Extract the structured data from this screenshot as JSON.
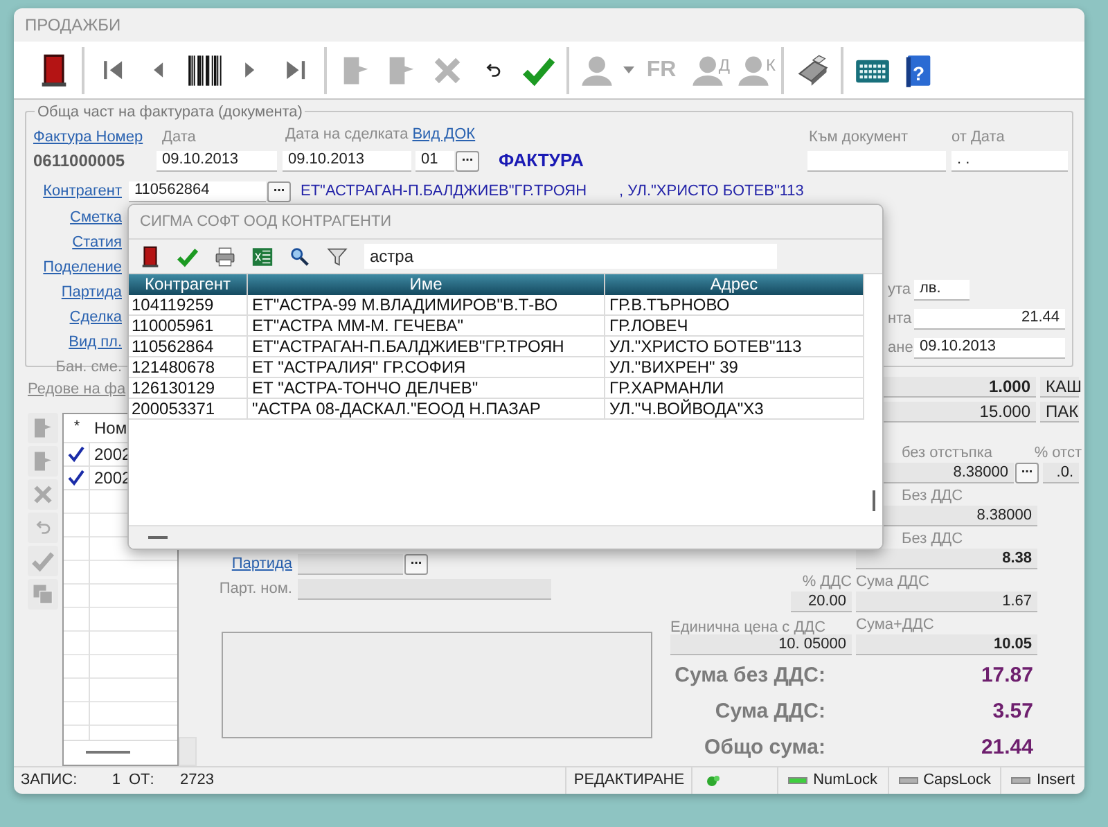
{
  "window": {
    "title": "ПРОДАЖБИ"
  },
  "toolbar": [
    [
      {
        "kind": "exit",
        "disabled": false
      }
    ],
    [
      {
        "kind": "first",
        "disabled": false
      },
      {
        "kind": "prev",
        "disabled": false
      },
      {
        "kind": "barcode",
        "disabled": false
      },
      {
        "kind": "next",
        "disabled": false
      },
      {
        "kind": "last",
        "disabled": false
      }
    ],
    [
      {
        "kind": "add",
        "disabled": true
      },
      {
        "kind": "edit",
        "disabled": true
      },
      {
        "kind": "delete",
        "disabled": true
      },
      {
        "kind": "undo",
        "disabled": false
      },
      {
        "kind": "confirm",
        "disabled": false
      }
    ],
    [
      {
        "kind": "person-menu",
        "disabled": true
      },
      {
        "kind": "fiscal",
        "disabled": true,
        "label": "FR"
      },
      {
        "kind": "person",
        "disabled": true,
        "label": "Д"
      },
      {
        "kind": "person",
        "disabled": true,
        "label": "К"
      }
    ],
    [
      {
        "kind": "register",
        "disabled": false
      }
    ],
    [
      {
        "kind": "calculator",
        "disabled": false
      },
      {
        "kind": "help",
        "disabled": false,
        "label": "?"
      }
    ]
  ],
  "document": {
    "legend": "Обща част на фактурата (документа)",
    "invoice_number_link": "Фактура Номер",
    "invoice_number": "0611000005",
    "date_label": "Дата",
    "date": "09.10.2013",
    "deal_date_label": "Дата на сделката",
    "deal_date": "09.10.2013",
    "doc_type_link": "Вид ДОК",
    "doc_type": "01",
    "doc_type_button": "...",
    "doc_type_name": "ФАКТУРА",
    "to_document_label": "Към документ",
    "from_date_label": "от Дата",
    "from_date": ". .",
    "partner_link": "Контрагент",
    "partner": "110562864",
    "partner_button": "...",
    "partner_name": "ЕТ\"АСТРАГАН-П.БАЛДЖИЕВ\"ГР.ТРОЯН",
    "partner_address": ", УЛ.\"ХРИСТО БОТЕВ\"113",
    "side_labels": [
      {
        "text": "Сметка",
        "kind": "link"
      },
      {
        "text": "Статия",
        "kind": "link"
      },
      {
        "text": "Поделение",
        "kind": "link"
      },
      {
        "text": "Партида",
        "kind": "link"
      },
      {
        "text": "Сделка",
        "kind": "link"
      },
      {
        "text": "Вид пл.",
        "kind": "link"
      },
      {
        "text": "Бан. сме.",
        "kind": "label"
      }
    ],
    "right_fields": [
      {
        "label": "ута",
        "value": "лв.",
        "kind": "short"
      },
      {
        "label": "нта",
        "value": "21.44",
        "kind": "amount"
      },
      {
        "label": "ане",
        "value": "09.10.2013",
        "kind": "date"
      }
    ]
  },
  "lines": {
    "title": "Редове на фа",
    "toolbar": [
      {
        "kind": "add",
        "disabled": true
      },
      {
        "kind": "edit",
        "disabled": true
      },
      {
        "kind": "delete",
        "disabled": true
      },
      {
        "kind": "undo",
        "disabled": true
      },
      {
        "kind": "confirm",
        "disabled": true
      },
      {
        "kind": "copy",
        "disabled": true
      }
    ],
    "grid": {
      "columns": [
        "*",
        "Ном"
      ],
      "rows": [
        {
          "checked": true,
          "number": "2002"
        },
        {
          "checked": true,
          "number": "2002"
        }
      ]
    },
    "batch_link": "Партида",
    "batch_button": "...",
    "batch_number_label": "Парт. ном."
  },
  "quantities": [
    {
      "value": "1.000",
      "bold": true,
      "unit": "КАШ"
    },
    {
      "value": "15.000",
      "bold": false,
      "unit": "ПАК"
    }
  ],
  "pricing": {
    "price_no_discount_label": "без отстъпка",
    "discount_label": "% отст",
    "price_no_discount": "8.38000",
    "price_button": "...",
    "discount": ".0.",
    "price_no_vat_label": "Без ДДС",
    "price_no_vat": "8.38000",
    "sum_no_vat_label": "Без ДДС",
    "sum_no_vat": "8.38",
    "vat_pct_label": "% ДДС",
    "vat_pct": "20.00",
    "vat_sum_label": "Сума ДДС",
    "vat_sum": "1.67",
    "unit_price_vat_label": "Единична цена с ДДС",
    "unit_price_vat": "10. 05000",
    "sum_with_vat_label": "Сума+ДДС",
    "sum_with_vat": "10.05"
  },
  "totals": [
    {
      "label": "Сума без ДДС:",
      "value": "17.87"
    },
    {
      "label": "Сума ДДС:",
      "value": "3.57"
    },
    {
      "label": "Общо сума:",
      "value": "21.44"
    }
  ],
  "status_bar": {
    "record_label": "ЗАПИС:",
    "record": "1",
    "of_label": "ОТ:",
    "total": "2723",
    "mode": "РЕДАКТИРАНЕ",
    "keys": [
      {
        "label": "NumLock",
        "on": true
      },
      {
        "label": "CapsLock",
        "on": false
      },
      {
        "label": "Insert",
        "on": false
      }
    ]
  },
  "dialog": {
    "title": "СИГМА СОФТ ООД КОНТРАГЕНТИ",
    "search": "астра",
    "toolbar": [
      {
        "kind": "exit"
      },
      {
        "kind": "confirm"
      },
      {
        "kind": "print"
      },
      {
        "kind": "excel"
      },
      {
        "kind": "search"
      },
      {
        "kind": "filter"
      }
    ],
    "columns": [
      "Контрагент",
      "Име",
      "Адрес"
    ],
    "rows": [
      [
        "104119259",
        "ЕТ\"АСТРА-99 М.ВЛАДИМИРОВ\"В.Т-ВО",
        "ГР.В.ТЪРНОВО"
      ],
      [
        "110005961",
        "ЕТ\"АСТРА ММ-М. ГЕЧЕВА\"",
        "ГР.ЛОВЕЧ"
      ],
      [
        "110562864",
        "ЕТ\"АСТРАГАН-П.БАЛДЖИЕВ\"ГР.ТРОЯН",
        "УЛ.\"ХРИСТО БОТЕВ\"113"
      ],
      [
        "121480678",
        "ЕТ \"АСТРАЛИЯ\" ГР.СОФИЯ",
        "УЛ.\"ВИХРЕН\" 39"
      ],
      [
        "126130129",
        "ЕТ \"АСТРА-ТОНЧО ДЕЛЧЕВ\"",
        "ГР.ХАРМАНЛИ"
      ],
      [
        "200053371",
        "\"АСТРА 08-ДАСКАЛ.\"ЕООД Н.ПАЗАР",
        "УЛ.\"Ч.ВОЙВОДА\"Х3"
      ]
    ]
  }
}
